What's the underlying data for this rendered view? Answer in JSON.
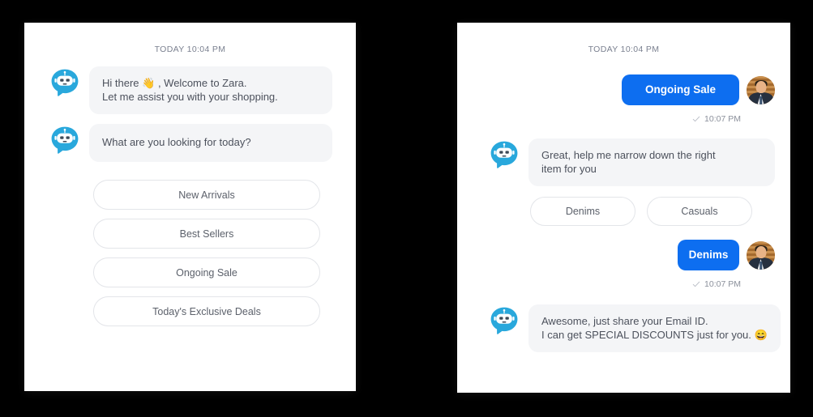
{
  "theme": {
    "page_background": "#000000",
    "card_background": "#ffffff",
    "bot_bubble_background": "#f4f5f7",
    "user_bubble_background": "#0d6ef0",
    "bot_avatar_color": "#29a8dc",
    "pill_border_color": "#e3e5e9",
    "muted_text_color": "#7b8190"
  },
  "left_panel": {
    "day_divider": "TODAY 10:04 PM",
    "messages": [
      {
        "sender": "bot",
        "avatar_icon": "chatbot-avatar-icon",
        "lines": [
          {
            "pre": "Hi there ",
            "emoji": "👋",
            "post": " , Welcome to Zara."
          },
          {
            "pre": "Let me assist you with your shopping.",
            "emoji": "",
            "post": ""
          }
        ]
      },
      {
        "sender": "bot",
        "avatar_icon": "chatbot-avatar-icon",
        "lines": [
          {
            "pre": "What are you looking for today?",
            "emoji": "",
            "post": ""
          }
        ]
      }
    ],
    "quick_replies": [
      "New Arrivals",
      "Best Sellers",
      "Ongoing Sale",
      "Today's Exclusive Deals"
    ]
  },
  "right_panel": {
    "day_divider": "TODAY 10:04 PM",
    "user_message_1": {
      "text": "Ongoing Sale",
      "receipt_time": "10:07 PM",
      "receipt_icon": "single-check-icon",
      "avatar_icon": "user-avatar-photo"
    },
    "bot_message_1": {
      "avatar_icon": "chatbot-avatar-icon",
      "lines": [
        {
          "pre": "Great, help me narrow down the right",
          "emoji": "",
          "post": ""
        },
        {
          "pre": "item for you",
          "emoji": "",
          "post": ""
        }
      ]
    },
    "quick_replies": [
      "Denims",
      "Casuals"
    ],
    "user_message_2": {
      "text": "Denims",
      "receipt_time": "10:07 PM",
      "receipt_icon": "single-check-icon",
      "avatar_icon": "user-avatar-photo"
    },
    "bot_message_2": {
      "avatar_icon": "chatbot-avatar-icon",
      "lines": [
        {
          "pre": "Awesome, just share your Email ID.",
          "emoji": "",
          "post": ""
        },
        {
          "pre": "I can get SPECIAL DISCOUNTS just for you. ",
          "emoji": "😄",
          "post": ""
        }
      ]
    }
  }
}
